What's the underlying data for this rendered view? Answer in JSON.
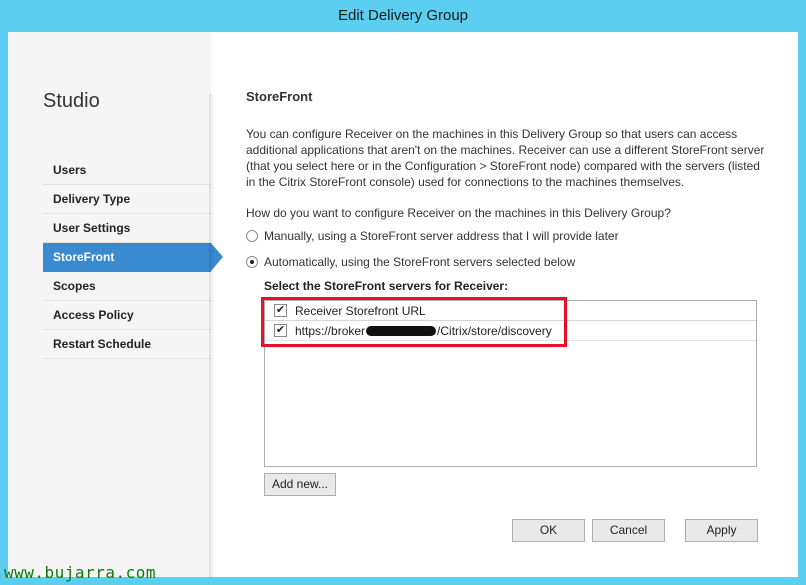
{
  "window": {
    "title": "Edit Delivery Group"
  },
  "sidebar": {
    "title": "Studio",
    "items": [
      {
        "label": "Users"
      },
      {
        "label": "Delivery Type"
      },
      {
        "label": "User Settings"
      },
      {
        "label": "StoreFront",
        "active": true
      },
      {
        "label": "Scopes"
      },
      {
        "label": "Access Policy"
      },
      {
        "label": "Restart Schedule"
      }
    ]
  },
  "main": {
    "section_title": "StoreFront",
    "description": "You can configure Receiver on the machines in this Delivery Group so that users can access additional applications that aren't on the machines. Receiver can use a different StoreFront server (that you select here or in the Configuration > StoreFront node) compared with the servers (listed in the Citrix StoreFront console) used for connections to the machines themselves.",
    "question": "How do you want to configure Receiver on the machines in this Delivery Group?",
    "options": [
      {
        "label": "Manually, using a StoreFront server address that I will provide later",
        "selected": false
      },
      {
        "label": "Automatically, using the StoreFront servers selected below",
        "selected": true
      }
    ],
    "select_label": "Select the StoreFront servers for Receiver:",
    "list": {
      "header": "Receiver Storefront URL",
      "header_checked": true,
      "rows": [
        {
          "url_prefix": "https://broker",
          "url_suffix": "/Citrix/store/discovery",
          "checked": true
        }
      ]
    },
    "add_new_label": "Add new...",
    "highlight_color": "#e8112d"
  },
  "footer": {
    "ok_label": "OK",
    "cancel_label": "Cancel",
    "apply_label": "Apply"
  },
  "watermark": "www.bujarra.com",
  "colors": {
    "titlebar": "#5ccff0",
    "accent": "#3a8ad0"
  }
}
